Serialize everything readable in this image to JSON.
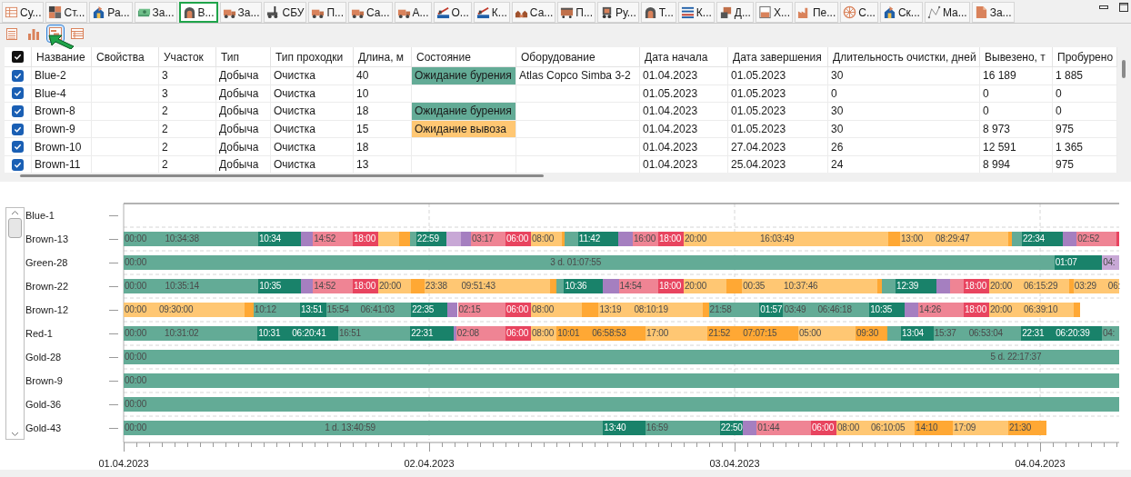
{
  "tabs": [
    {
      "label": "Су...",
      "selected": false
    },
    {
      "label": "Ст...",
      "selected": false
    },
    {
      "label": "Ра...",
      "selected": false
    },
    {
      "label": "За...",
      "selected": false
    },
    {
      "label": "В...",
      "selected": true
    },
    {
      "label": "За...",
      "selected": false
    },
    {
      "label": "СБУ",
      "selected": false
    },
    {
      "label": "П...",
      "selected": false
    },
    {
      "label": "Са...",
      "selected": false
    },
    {
      "label": "А...",
      "selected": false
    },
    {
      "label": "О...",
      "selected": false
    },
    {
      "label": "К...",
      "selected": false
    },
    {
      "label": "Са...",
      "selected": false
    },
    {
      "label": "П...",
      "selected": false
    },
    {
      "label": "Ру...",
      "selected": false
    },
    {
      "label": "Т...",
      "selected": false
    },
    {
      "label": "К...",
      "selected": false
    },
    {
      "label": "Д...",
      "selected": false
    },
    {
      "label": "Х...",
      "selected": false
    },
    {
      "label": "Пе...",
      "selected": false
    },
    {
      "label": "С...",
      "selected": false
    },
    {
      "label": "Ск...",
      "selected": false
    },
    {
      "label": "Ма...",
      "selected": false
    },
    {
      "label": "За...",
      "selected": false
    }
  ],
  "view_buttons": [
    {
      "kind": "table",
      "selected": false
    },
    {
      "kind": "chart",
      "selected": false
    },
    {
      "kind": "gantt",
      "selected": true
    },
    {
      "kind": "report",
      "selected": false
    }
  ],
  "table": {
    "all_checked": true,
    "columns": [
      "Название",
      "Свойства",
      "Участок",
      "Тип",
      "Тип проходки",
      "Длина, м",
      "Состояние",
      "Оборудование",
      "Дата начала",
      "Дата завершения",
      "Длительность очистки, дней",
      "Вывезено, т",
      "Пробурено"
    ],
    "rows": [
      {
        "checked": true,
        "cells": [
          "Blue-2",
          null,
          "3",
          "Добыча",
          "Очистка",
          "40",
          {
            "text": "Ожидание бурения",
            "color": "#63ab96"
          },
          "Atlas Copco Simba 3-2",
          "01.04.2023",
          "01.05.2023",
          "30",
          "16 189",
          "1 885"
        ]
      },
      {
        "checked": true,
        "cells": [
          "Blue-4",
          null,
          "3",
          "Добыча",
          "Очистка",
          "10",
          null,
          null,
          "01.05.2023",
          "01.05.2023",
          "0",
          "0",
          "0"
        ]
      },
      {
        "checked": true,
        "cells": [
          "Brown-8",
          null,
          "2",
          "Добыча",
          "Очистка",
          "18",
          {
            "text": "Ожидание бурения",
            "color": "#63ab96"
          },
          null,
          "01.04.2023",
          "01.05.2023",
          "30",
          "0",
          "0"
        ]
      },
      {
        "checked": true,
        "cells": [
          "Brown-9",
          null,
          "2",
          "Добыча",
          "Очистка",
          "15",
          {
            "text": "Ожидание вывоза",
            "color": "#ffc773"
          },
          null,
          "01.04.2023",
          "01.05.2023",
          "30",
          "8 973",
          "975"
        ]
      },
      {
        "checked": true,
        "cells": [
          "Brown-10",
          null,
          "2",
          "Добыча",
          "Очистка",
          "18",
          null,
          null,
          "01.04.2023",
          "27.04.2023",
          "26",
          "12 591",
          "1 365"
        ]
      },
      {
        "checked": true,
        "cells": [
          "Brown-11",
          null,
          "2",
          "Добыча",
          "Очистка",
          "13",
          null,
          null,
          "01.04.2023",
          "25.04.2023",
          "24",
          "8 994",
          "975"
        ]
      }
    ]
  },
  "gantt": {
    "axis_labels": [
      "01.04.2023",
      "02.04.2023",
      "03.04.2023",
      "04.04.2023"
    ],
    "rows": [
      {
        "label": "Blue-1"
      },
      {
        "label": "Brown-13",
        "segments": [
          {
            "color": "#63ab96",
            "time": "00:00",
            "note": "10:34:38"
          },
          {
            "color": "#19826a",
            "time": "10:34"
          },
          {
            "color": "#a57fc0"
          },
          {
            "color": "#ef8494",
            "time": "14:52"
          },
          {
            "color": "#e8445f",
            "time": "18:00"
          },
          {
            "color": "#ffc773"
          },
          {
            "color": "#ffa834"
          },
          {
            "color": "#63ab96"
          },
          {
            "color": "#19826a",
            "time": "22:59"
          },
          {
            "color": "#c8a8d6"
          },
          {
            "color": "#a57fc0"
          },
          {
            "color": "#ef8494",
            "time": "03:17"
          },
          {
            "color": "#e8445f",
            "time": "06:00"
          },
          {
            "color": "#ffc773",
            "time": "08:00"
          },
          {
            "color": "#ffa834"
          },
          {
            "color": "#63ab96"
          },
          {
            "color": "#19826a",
            "time": "11:42"
          },
          {
            "color": "#a57fc0"
          },
          {
            "color": "#ef8494",
            "time": "16:00"
          },
          {
            "color": "#e8445f",
            "time": "18:00"
          },
          {
            "color": "#ffc773",
            "time": "20:00",
            "note": "16:03:49"
          },
          {
            "color": "#ffa834"
          },
          {
            "color": "#ffc773",
            "time": "13:00",
            "note": "08:29:47"
          },
          {
            "color": "#ffa834"
          },
          {
            "color": "#63ab96"
          },
          {
            "color": "#19826a",
            "time": "22:34"
          },
          {
            "color": "#a57fc0"
          },
          {
            "color": "#ef8494",
            "time": "02:52"
          },
          {
            "color": "#e8445f"
          }
        ]
      },
      {
        "label": "Green-28",
        "segments": [
          {
            "color": "#63ab96",
            "time": "00:00",
            "note": "3 d. 01:07:55"
          },
          {
            "color": "#19826a",
            "time": "01:07"
          },
          {
            "color": "#c8a8d6",
            "time": "04:"
          }
        ]
      },
      {
        "label": "Brown-22",
        "segments": [
          {
            "color": "#63ab96",
            "time": "00:00",
            "note": "10:35:14"
          },
          {
            "color": "#19826a",
            "time": "10:35"
          },
          {
            "color": "#a57fc0"
          },
          {
            "color": "#ef8494",
            "time": "14:52"
          },
          {
            "color": "#e8445f",
            "time": "18:00"
          },
          {
            "color": "#ffc773",
            "time": "20:00"
          },
          {
            "color": "#ffa834"
          },
          {
            "color": "#ffc773",
            "time": "23:38",
            "note": "09:51:43"
          },
          {
            "color": "#ffa834"
          },
          {
            "color": "#63ab96"
          },
          {
            "color": "#19826a",
            "time": "10:36"
          },
          {
            "color": "#a57fc0"
          },
          {
            "color": "#ef8494",
            "time": "14:54"
          },
          {
            "color": "#e8445f",
            "time": "18:00"
          },
          {
            "color": "#ffc773",
            "time": "20:00"
          },
          {
            "color": "#ffa834"
          },
          {
            "color": "#ffc773",
            "time": "00:35",
            "note": "10:37:46"
          },
          {
            "color": "#ffa834"
          },
          {
            "color": "#63ab96"
          },
          {
            "color": "#19826a",
            "time": "12:39"
          },
          {
            "color": "#a57fc0"
          },
          {
            "color": "#ef8494"
          },
          {
            "color": "#e8445f",
            "time": "18:00"
          },
          {
            "color": "#ffc773",
            "time": "20:00",
            "note": "06:15:29"
          },
          {
            "color": "#ffa834"
          },
          {
            "color": "#ffc773",
            "time": "03:29",
            "note": "06:"
          }
        ]
      },
      {
        "label": "Brown-12",
        "segments": [
          {
            "color": "#ffc773",
            "time": "00:00",
            "note": "09:30:00"
          },
          {
            "color": "#ffa834"
          },
          {
            "color": "#63ab96",
            "time": "10:12"
          },
          {
            "color": "#19826a",
            "time": "13:51"
          },
          {
            "color": "#63ab96",
            "time": "15:54",
            "note": "06:41:03"
          },
          {
            "color": "#19826a",
            "time": "22:35"
          },
          {
            "color": "#a57fc0"
          },
          {
            "color": "#ef8494",
            "time": "02:15"
          },
          {
            "color": "#e8445f",
            "time": "06:00"
          },
          {
            "color": "#ffc773",
            "time": "08:00"
          },
          {
            "color": "#ffa834"
          },
          {
            "color": "#ffc773",
            "time": "13:19",
            "note": "08:10:19"
          },
          {
            "color": "#ffa834"
          },
          {
            "color": "#63ab96",
            "time": "21:58"
          },
          {
            "color": "#19826a",
            "time": "01:57"
          },
          {
            "color": "#63ab96",
            "time": "03:49",
            "note": "06:46:18"
          },
          {
            "color": "#19826a",
            "time": "10:35"
          },
          {
            "color": "#a57fc0"
          },
          {
            "color": "#ef8494",
            "time": "14:26"
          },
          {
            "color": "#e8445f",
            "time": "18:00"
          },
          {
            "color": "#ffc773",
            "time": "20:00",
            "note": "06:39:10"
          },
          {
            "color": "#ffa834"
          }
        ]
      },
      {
        "label": "Red-1",
        "segments": [
          {
            "color": "#63ab96",
            "time": "00:00",
            "note": "10:31:02"
          },
          {
            "color": "#19826a",
            "time": "10:31",
            "note": "06:20:41"
          },
          {
            "color": "#63ab96",
            "time": "16:51"
          },
          {
            "color": "#19826a",
            "time": "22:31"
          },
          {
            "color": "#a57fc0"
          },
          {
            "color": "#ef8494",
            "time": "02:08"
          },
          {
            "color": "#e8445f",
            "time": "06:00"
          },
          {
            "color": "#ffc773",
            "time": "08:00"
          },
          {
            "color": "#ffa834",
            "time": "10:01",
            "note": "06:58:53"
          },
          {
            "color": "#ffc773",
            "time": "17:00"
          },
          {
            "color": "#ffa834",
            "time": "21:52",
            "note": "07:07:15"
          },
          {
            "color": "#ffc773",
            "time": "05:00"
          },
          {
            "color": "#ffa834",
            "time": "09:30"
          },
          {
            "color": "#63ab96"
          },
          {
            "color": "#19826a",
            "time": "13:04"
          },
          {
            "color": "#63ab96",
            "time": "15:37",
            "note": "06:53:04"
          },
          {
            "color": "#19826a",
            "time": "22:31",
            "note": "06:20:39"
          },
          {
            "color": "#63ab96",
            "time": "04:"
          }
        ]
      },
      {
        "label": "Gold-28",
        "segments": [
          {
            "color": "#63ab96",
            "time": "00:00",
            "note": "5 d. 22:17:37"
          }
        ]
      },
      {
        "label": "Brown-9",
        "segments": [
          {
            "color": "#63ab96",
            "time": "00:00"
          }
        ]
      },
      {
        "label": "Gold-36",
        "segments": [
          {
            "color": "#63ab96",
            "time": "00:00"
          }
        ]
      },
      {
        "label": "Gold-43",
        "segments": [
          {
            "color": "#63ab96",
            "time": "00:00",
            "note": "1 d. 13:40:59"
          },
          {
            "color": "#19826a",
            "time": "13:40"
          },
          {
            "color": "#63ab96",
            "time": "16:59"
          },
          {
            "color": "#19826a",
            "time": "22:50"
          },
          {
            "color": "#a57fc0"
          },
          {
            "color": "#ef8494",
            "time": "01:44"
          },
          {
            "color": "#e8445f",
            "time": "06:00"
          },
          {
            "color": "#ffc773",
            "time": "08:00",
            "note": "06:10:05"
          },
          {
            "color": "#ffa834",
            "time": "14:10"
          },
          {
            "color": "#ffc773",
            "time": "17:09"
          },
          {
            "color": "#ffa834",
            "time": "21:30"
          }
        ]
      }
    ]
  }
}
